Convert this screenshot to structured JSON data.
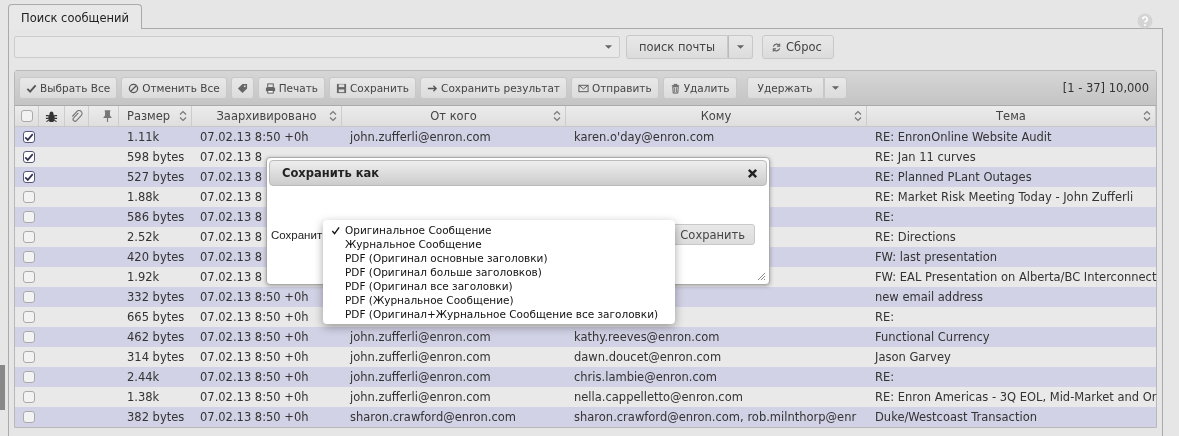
{
  "tabs": [
    {
      "label": "Поиск сообщений",
      "selected": true
    }
  ],
  "search": {
    "search_button": "поиск почты",
    "reset_button": "Сброс"
  },
  "toolbar": {
    "buttons": [
      {
        "kind": "button",
        "label": "Выбрать Все"
      },
      {
        "kind": "button",
        "label": "Отменить Все"
      },
      {
        "kind": "icon"
      },
      {
        "kind": "button",
        "label": "Печать"
      },
      {
        "kind": "button",
        "label": "Сохранить"
      },
      {
        "kind": "button",
        "label": "Сохранить результат"
      },
      {
        "kind": "button",
        "label": "Отправить"
      },
      {
        "kind": "button",
        "label": "Удалить"
      },
      {
        "kind": "split",
        "label": "Удержать"
      }
    ],
    "range": "[1 - 37] 10,000"
  },
  "table": {
    "header_checked": false,
    "columns": [
      "Размер",
      "Заархивировано",
      "От кого",
      "Кому",
      "Тема"
    ],
    "rows": [
      {
        "checked": true,
        "size": "1.11k",
        "archived": "07.02.13 8:50 +0h",
        "from": "john.zufferli@enron.com",
        "to": "karen.o'day@enron.com",
        "subject": "RE: EnronOnline Website Audit"
      },
      {
        "checked": true,
        "size": "598 bytes",
        "archived": "07.02.13 8",
        "subject": "RE: Jan 11 curves"
      },
      {
        "checked": true,
        "size": "527 bytes",
        "archived": "07.02.13 8",
        "subject": "RE: Planned PLant Outages"
      },
      {
        "checked": false,
        "size": "1.88k",
        "archived": "07.02.13 8",
        "subject": "RE: Market Risk Meeting Today - John Zufferli"
      },
      {
        "checked": false,
        "size": "586 bytes",
        "archived": "07.02.13 8",
        "subject": "RE:"
      },
      {
        "checked": false,
        "size": "2.52k",
        "archived": "07.02.13 8",
        "subject": "RE: Directions"
      },
      {
        "checked": false,
        "size": "420 bytes",
        "archived": "07.02.13 8",
        "subject": "FW: last presentation"
      },
      {
        "checked": false,
        "size": "1.92k",
        "archived": "07.02.13 8",
        "subject": "FW: EAL Presentation on Alberta/BC Interconnect"
      },
      {
        "checked": false,
        "size": "332 bytes",
        "archived": "07.02.13 8:50 +0h",
        "subject": "new email address"
      },
      {
        "checked": false,
        "size": "665 bytes",
        "archived": "07.02.13 8:50 +0h",
        "subject": "RE:"
      },
      {
        "checked": false,
        "size": "462 bytes",
        "archived": "07.02.13 8:50 +0h",
        "from": "john.zufferli@enron.com",
        "to": "kathy.reeves@enron.com",
        "subject": "Functional Currency"
      },
      {
        "checked": false,
        "size": "314 bytes",
        "archived": "07.02.13 8:50 +0h",
        "from": "john.zufferli@enron.com",
        "to": "dawn.doucet@enron.com",
        "subject": "Jason Garvey"
      },
      {
        "checked": false,
        "size": "2.44k",
        "archived": "07.02.13 8:50 +0h",
        "from": "john.zufferli@enron.com",
        "to": "chris.lambie@enron.com",
        "subject": "RE:"
      },
      {
        "checked": false,
        "size": "1.38k",
        "archived": "07.02.13 8:50 +0h",
        "from": "john.zufferli@enron.com",
        "to": "nella.cappelletto@enron.com",
        "subject": "RE: Enron Americas - 3Q EOL, Mid-Market and Or"
      },
      {
        "checked": false,
        "size": "382 bytes",
        "archived": "07.02.13 8:50 +0h",
        "from": "sharon.crawford@enron.com",
        "to": "sharon.crawford@enron.com, rob.milnthorp@enr",
        "subject": "Duke/Westcoast Transaction"
      }
    ]
  },
  "dialog": {
    "title": "Сохранить как",
    "label": "Сохранит",
    "button": "Сохранить",
    "options": [
      {
        "label": "Оригинальное Сообщение",
        "selected": true
      },
      {
        "label": "Журнальное Сообщение",
        "selected": false
      },
      {
        "label": "PDF (Оригинал основные заголовки)",
        "selected": false
      },
      {
        "label": "PDF (Оригинал больше заголовков)",
        "selected": false
      },
      {
        "label": "PDF (Оригинал все заголовки)",
        "selected": false
      },
      {
        "label": "PDF (Журнальное Сообщение)",
        "selected": false
      },
      {
        "label": "PDF (Оригинал+Журнальное Сообщение все заголовки)",
        "selected": false
      }
    ]
  }
}
